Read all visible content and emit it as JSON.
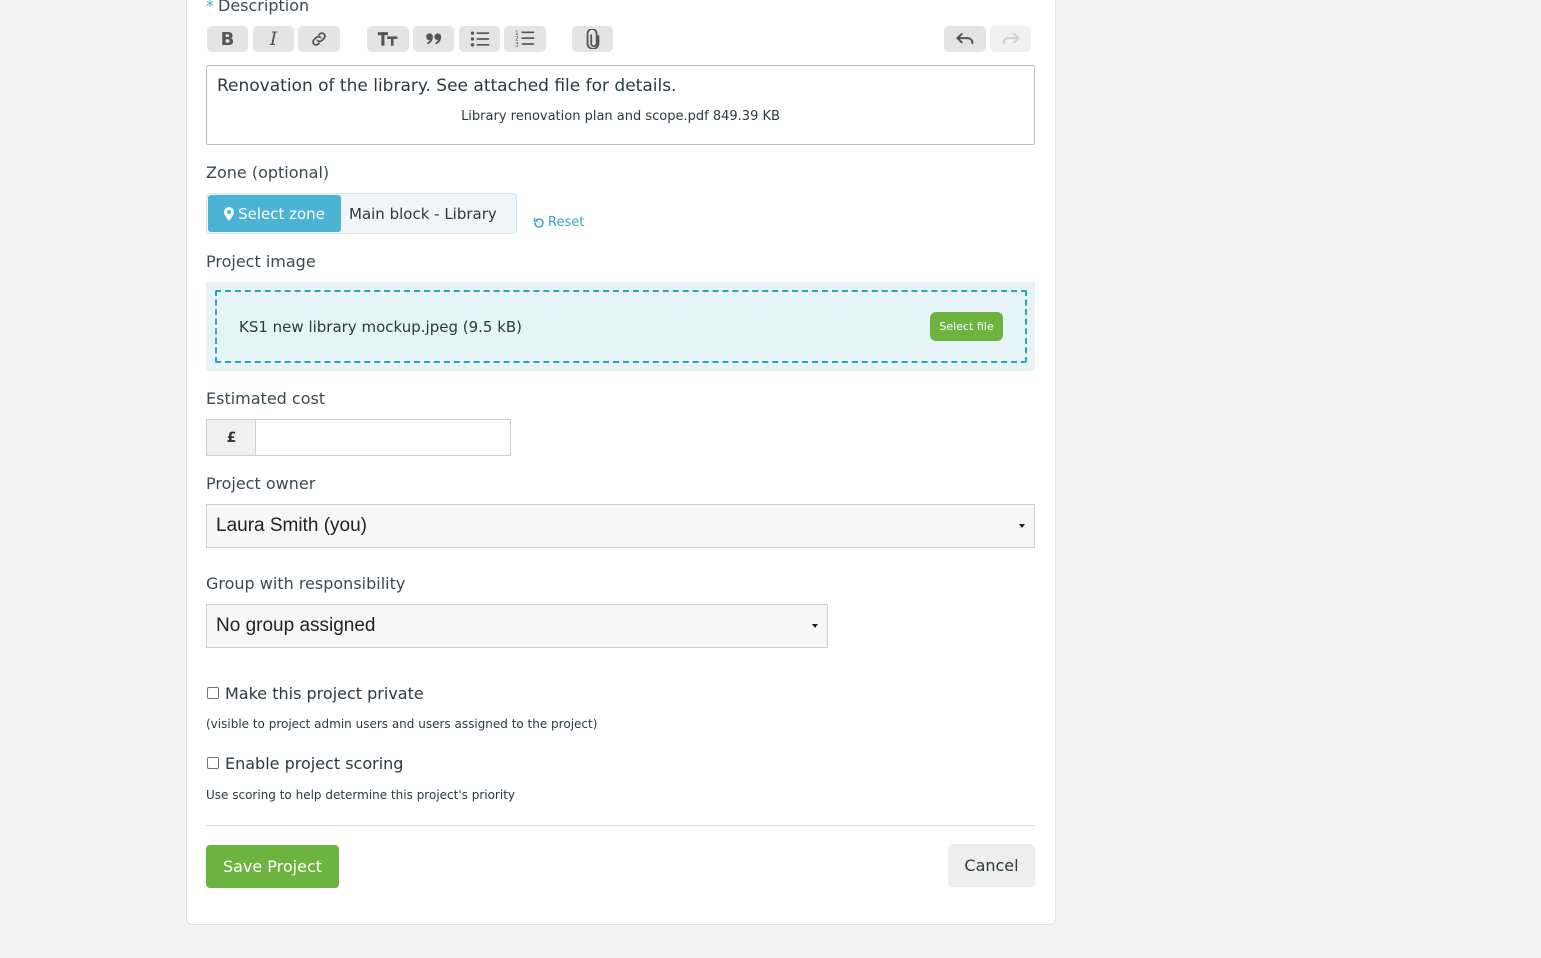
{
  "description": {
    "required_marker": "*",
    "label": "Description",
    "text": "Renovation of the library. See attached file for details.",
    "attachment": "Library renovation plan and scope.pdf 849.39 KB"
  },
  "toolbar": {
    "buttons": [
      "bold-icon",
      "italic-icon",
      "link-icon",
      "heading-icon",
      "quote-icon",
      "bullet-list-icon",
      "numbered-list-icon",
      "attach-icon",
      "undo-icon",
      "redo-icon"
    ]
  },
  "zone": {
    "label": "Zone (optional)",
    "select_button": "Select zone",
    "value": "Main block - Library",
    "reset": "Reset"
  },
  "project_image": {
    "label": "Project image",
    "file_name": "KS1 new library mockup.jpeg (9.5 kB)",
    "select_file": "Select file"
  },
  "estimated_cost": {
    "label": "Estimated cost",
    "currency": "£",
    "value": ""
  },
  "project_owner": {
    "label": "Project owner",
    "value": "Laura Smith (you)"
  },
  "group": {
    "label": "Group with responsibility",
    "value": "No group assigned"
  },
  "private": {
    "label": "Make this project private",
    "help": "(visible to project admin users and users assigned to the project)",
    "checked": false
  },
  "scoring": {
    "label": "Enable project scoring",
    "help": "Use scoring to help determine this project's priority",
    "checked": false
  },
  "actions": {
    "save": "Save Project",
    "cancel": "Cancel"
  },
  "colors": {
    "accent": "#4bb3d3",
    "primary_green": "#6db33f"
  }
}
